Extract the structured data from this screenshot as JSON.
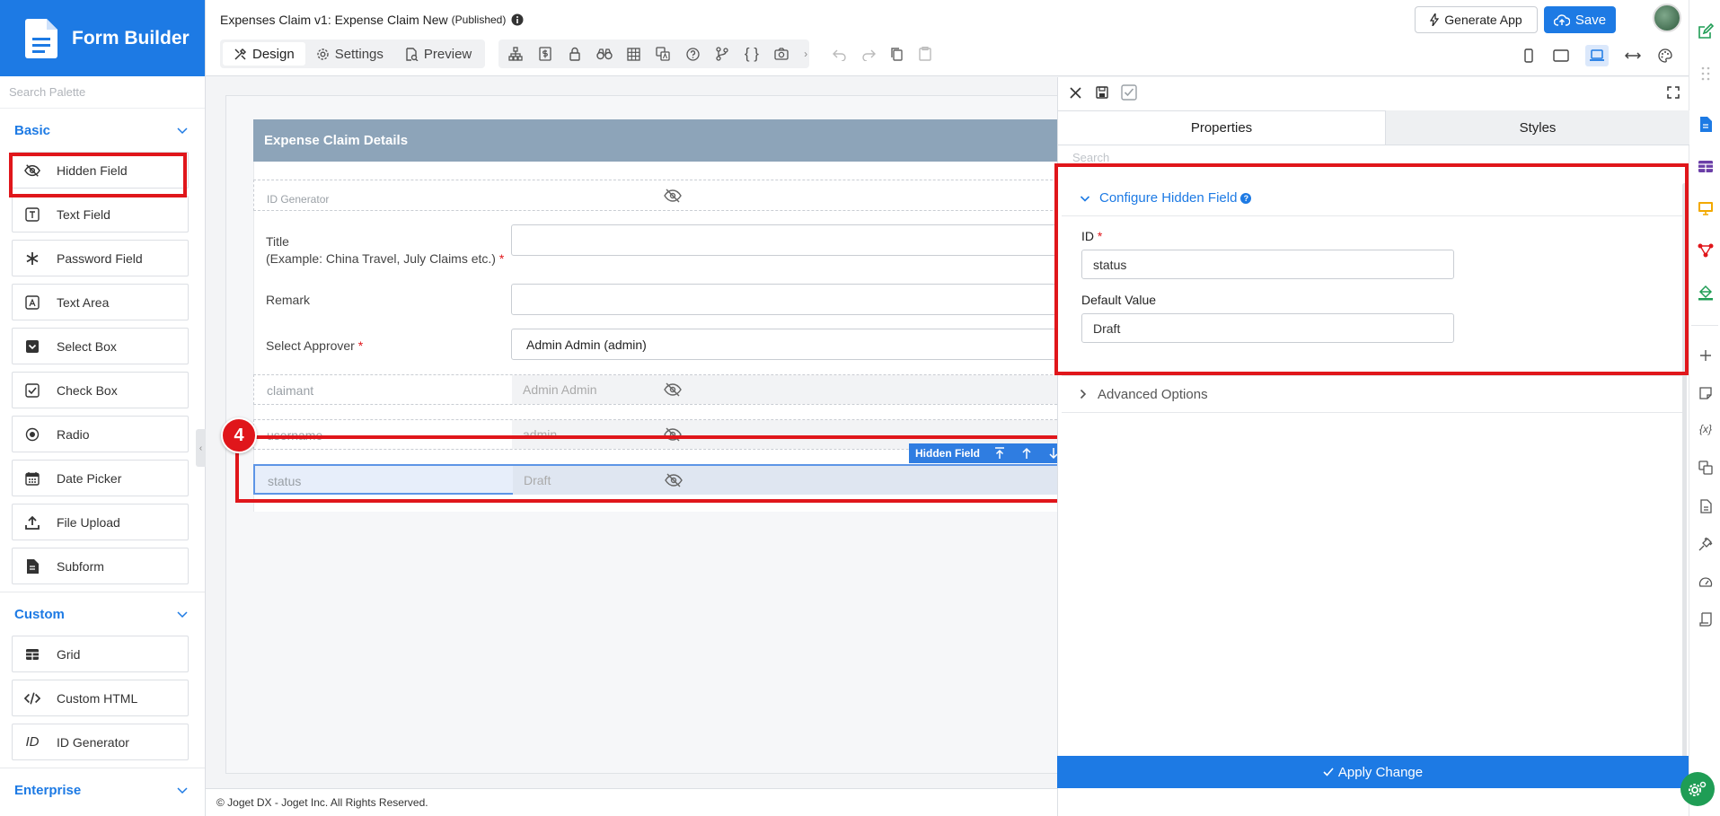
{
  "brand": {
    "title": "Form Builder"
  },
  "palette": {
    "search_placeholder": "Search Palette",
    "categories": [
      {
        "label": "Basic",
        "items": [
          {
            "label": "Hidden Field",
            "icon": "eye-slash-icon"
          },
          {
            "label": "Text Field",
            "icon": "text-field-icon"
          },
          {
            "label": "Password Field",
            "icon": "asterisk-icon"
          },
          {
            "label": "Text Area",
            "icon": "text-area-icon"
          },
          {
            "label": "Select Box",
            "icon": "select-box-icon"
          },
          {
            "label": "Check Box",
            "icon": "checkbox-icon"
          },
          {
            "label": "Radio",
            "icon": "radio-icon"
          },
          {
            "label": "Date Picker",
            "icon": "calendar-icon"
          },
          {
            "label": "File Upload",
            "icon": "upload-icon"
          },
          {
            "label": "Subform",
            "icon": "subform-icon"
          }
        ]
      },
      {
        "label": "Custom",
        "items": [
          {
            "label": "Grid",
            "icon": "grid-icon"
          },
          {
            "label": "Custom HTML",
            "icon": "code-icon"
          },
          {
            "label": "ID Generator",
            "icon": "id-icon"
          }
        ]
      },
      {
        "label": "Enterprise",
        "items": []
      }
    ]
  },
  "header": {
    "form_title": "Expenses Claim v1: Expense Claim New",
    "status": "(Published)",
    "tabs": {
      "design": "Design",
      "settings": "Settings",
      "preview": "Preview"
    },
    "generate_app": "Generate App",
    "save": "Save"
  },
  "canvas": {
    "section_title": "Expense Claim Details",
    "rows": {
      "id_generator": {
        "label": "ID Generator"
      },
      "title": {
        "label_line1": "Title",
        "label_line2": "(Example: China Travel, July Claims etc.)",
        "required": "*"
      },
      "remark": {
        "label": "Remark"
      },
      "approver": {
        "label": "Select Approver",
        "required": "*",
        "value": "Admin Admin (admin)"
      },
      "claimant": {
        "label": "claimant",
        "value": "Admin Admin"
      },
      "username": {
        "label": "username",
        "value": "admin"
      },
      "status": {
        "label": "status",
        "value": "Draft"
      }
    },
    "selected_toolbar_label": "Hidden Field",
    "step_badge": "4"
  },
  "properties": {
    "tabs": {
      "properties": "Properties",
      "styles": "Styles"
    },
    "search_placeholder": "Search",
    "section_title": "Configure Hidden Field",
    "id_label": "ID",
    "id_required": "*",
    "id_value": "status",
    "default_label": "Default Value",
    "default_value": "Draft",
    "advanced": "Advanced Options",
    "apply": "Apply Change"
  },
  "footer": {
    "copyright": "© Joget DX - Joget Inc. All Rights Reserved."
  },
  "colors": {
    "accent": "#1d7ae4",
    "highlight": "#e0161b",
    "section_header": "#8da4b9"
  }
}
